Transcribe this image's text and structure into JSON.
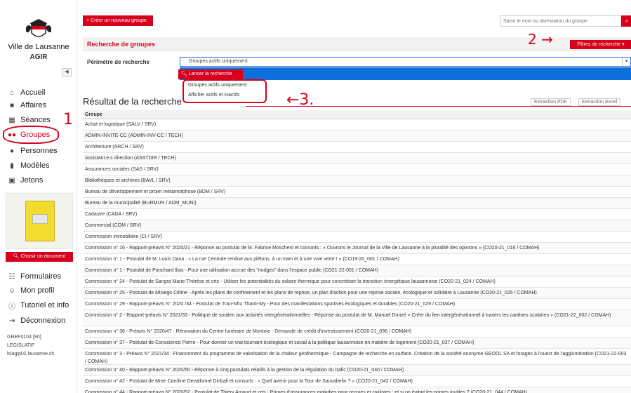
{
  "sidebar": {
    "city": "Ville de Lausanne",
    "app": "AGIR",
    "nav": [
      {
        "label": "Accueil",
        "icon": "home-icon"
      },
      {
        "label": "Affaires",
        "icon": "briefcase-icon"
      },
      {
        "label": "Séances",
        "icon": "calendar-icon"
      },
      {
        "label": "Groupes",
        "icon": "users-icon"
      },
      {
        "label": "Personnes",
        "icon": "user-icon"
      },
      {
        "label": "Modèles",
        "icon": "file-icon"
      },
      {
        "label": "Jetons",
        "icon": "token-icon"
      }
    ],
    "choose_document": "Choisir un document",
    "nav2": [
      {
        "label": "Formulaires",
        "icon": "forms-icon"
      },
      {
        "label": "Mon profil",
        "icon": "profile-icon"
      },
      {
        "label": "Tutoriel et info",
        "icon": "info-icon"
      },
      {
        "label": "Déconnexion",
        "icon": "logout-icon"
      }
    ],
    "footer": [
      "GREF0104 [80]",
      "LEGISLATIF",
      "lslagip02.lausanne.ch"
    ]
  },
  "toolbar": {
    "new_group": "+ Créer un nouveau groupe",
    "search_placeholder": "Saisir le nom ou abréviation du groupe"
  },
  "search_panel": {
    "title": "Recherche de groupes",
    "filters_button": "Filtres de recherche ▾",
    "perimeter_label": "Périmètre de recherche",
    "perimeter_value": "Groupes actifs uniquement",
    "launch_button": "Lancer la recherche",
    "options": [
      "Groupes actifs uniquement",
      "Afficher actifs et inactifs"
    ]
  },
  "annotations": {
    "one": "1",
    "two": "2 →",
    "three": "←3."
  },
  "results": {
    "title": "Résultat de la recherche",
    "export_pdf": "Extraction PDF",
    "export_excel": "Extraction Excel",
    "column": "Groupe",
    "rows": [
      "Achat et logistique (SALV / SRV)",
      "ADMIN-INVITE-CC (ADMIN-INV-CC / TECH)",
      "Architecture (ARCH / SRV)",
      "Assistant.e.s direction (ASSTDIR / TECH)",
      "Assurances sociales (SAS / SRV)",
      "Bibliothèques et archives (BAVL / SRV)",
      "Bureau de développement et projet métamorphose (BDM / SRV)",
      "Bureau de la municipalité (BURMUN / ADM_MUNI)",
      "Cadastre (CADA / SRV)",
      "Commercial (COM / SRV)",
      "Commission immobilière (CI / SRV)",
      "Commission n° 16 - Rapport-préavis N° 2020/21 - Réponse au postulat de M. Fabrice Moscheni et consorts : « Ouvrons le Journal de la Ville de Lausanne à la pluralité des opinions » (CO20-21_016 / COMAH)",
      "Commission n° 1 - Postulat de M. Louis Dana : « La rue Centrale rendue aux piétons, à un tram et à une voie verte ! » (CO19-20_001 / COMAH)",
      "Commission n° 1 - Postulat de Panchard Ilias - Pour une utilisation accrue des \"nudges\" dans l'espace public (CO21-22-001 / COMAH)",
      "Commission n° 24 - Postulat de Sangra Marie-Thérèse et crts - Utiliser les potentialités du solaire thermique pour concrétiser la transition énergétique lausannoise (CO20-21_024 / COMAH)",
      "Commission n° 25 - Postulat de Misiego Céline - Après les plans de confinement et les plans de reprise, un plan d'action pour une reprise sociale, écologique et solidaire à Lausanne (CO20-21_025 / COMAH)",
      "Commission n° 29 - Rapport-préavis N° 2020 /34 - Postulat de Tran-Nhu Thanh-My - Pour des manifestations sportives écologiques et durables (CO20-21_029 / COMAH)",
      "Commission n° 2 - Rapport-préavis N° 2021/33 - Politique de soutien aux activités intergénérationnelles - Réponse au postulat de M. Manuel Donzé « Créer du lien intergénérationnel à travers les cantines scolaires » (CO21-22_002 / COMAH)",
      "Commission n° 36 - Préavis N° 2020/47 - Rénovation du Centre funéraire de Montoie - Demande de crédit d'investissement (CO20-21_036 / COMAH)",
      "Commission n° 37 - Postulat de Conscience Pierre - Pour donner un vrai tournant écologique et social à la politique lausannoise en matière de logement (CO20-21_037 / COMAH)",
      "Commission n° 3 - Préavis N° 2021/34 : Financement du programme de valorisation de la chaleur géothermique - Campagne de recherche en surface. Création de la société anonyme GEOOL SA et forages à l'ouest de l'agglomération (CO21-22-003 / COMAH)",
      "Commission n° 40 - Rapport-préavis N° 2020/50 - Réponse à cinq postulats relatifs à la gestion de la régulation du trafic (CO20-21_040 / COMAH)",
      "Commission n° 42 - Postulat de Mme Caroline Devallonné Dinbali et consorts : « Quel avenir pour la Tour de Sauvabelin ? » (CO20-21_042 / COMAH)",
      "Commission n° 44 - Rapport-préavis N° 2020/52 - Postulat de Thiéry Arnaud et crts - Primes d'assurances maladies pour recrues et civilistes : et si on évitait les primes inutiles ? (CO20-21_044 / COMAH)"
    ]
  }
}
